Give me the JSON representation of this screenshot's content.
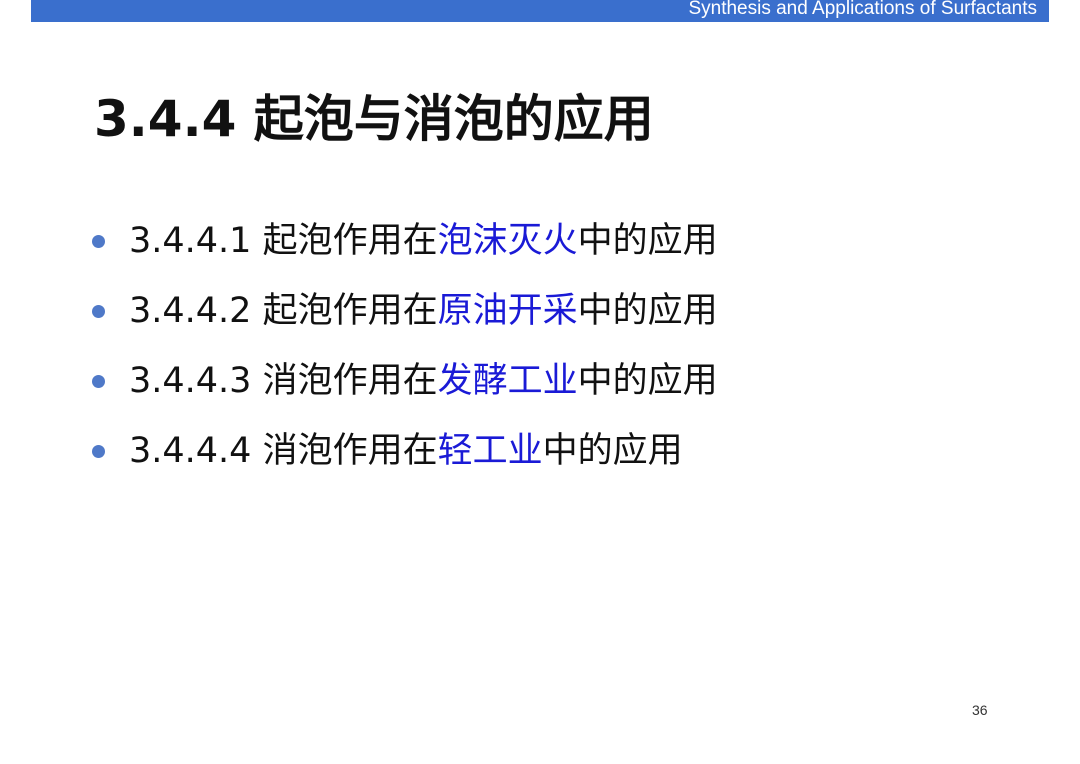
{
  "header": {
    "text": "Synthesis and Applications of Surfactants",
    "bar_color": "#3a6fcd"
  },
  "slide": {
    "title": "3.4.4 起泡与消泡的应用",
    "bullets": [
      {
        "number": "3.4.4.1",
        "prefix": "起泡作用在",
        "highlight": "泡沫灭火",
        "suffix": "中的应用"
      },
      {
        "number": "3.4.4.2",
        "prefix": "起泡作用在",
        "highlight": "原油开采",
        "suffix": "中的应用"
      },
      {
        "number": "3.4.4.3",
        "prefix": "消泡作用在",
        "highlight": "发酵工业",
        "suffix": "中的应用"
      },
      {
        "number": "3.4.4.4",
        "prefix": "消泡作用在",
        "highlight": "轻工业",
        "suffix": "中的应用"
      }
    ],
    "highlight_color": "#1a1ad6",
    "bullet_color": "#4f79c8"
  },
  "footer": {
    "page_number": "36"
  }
}
